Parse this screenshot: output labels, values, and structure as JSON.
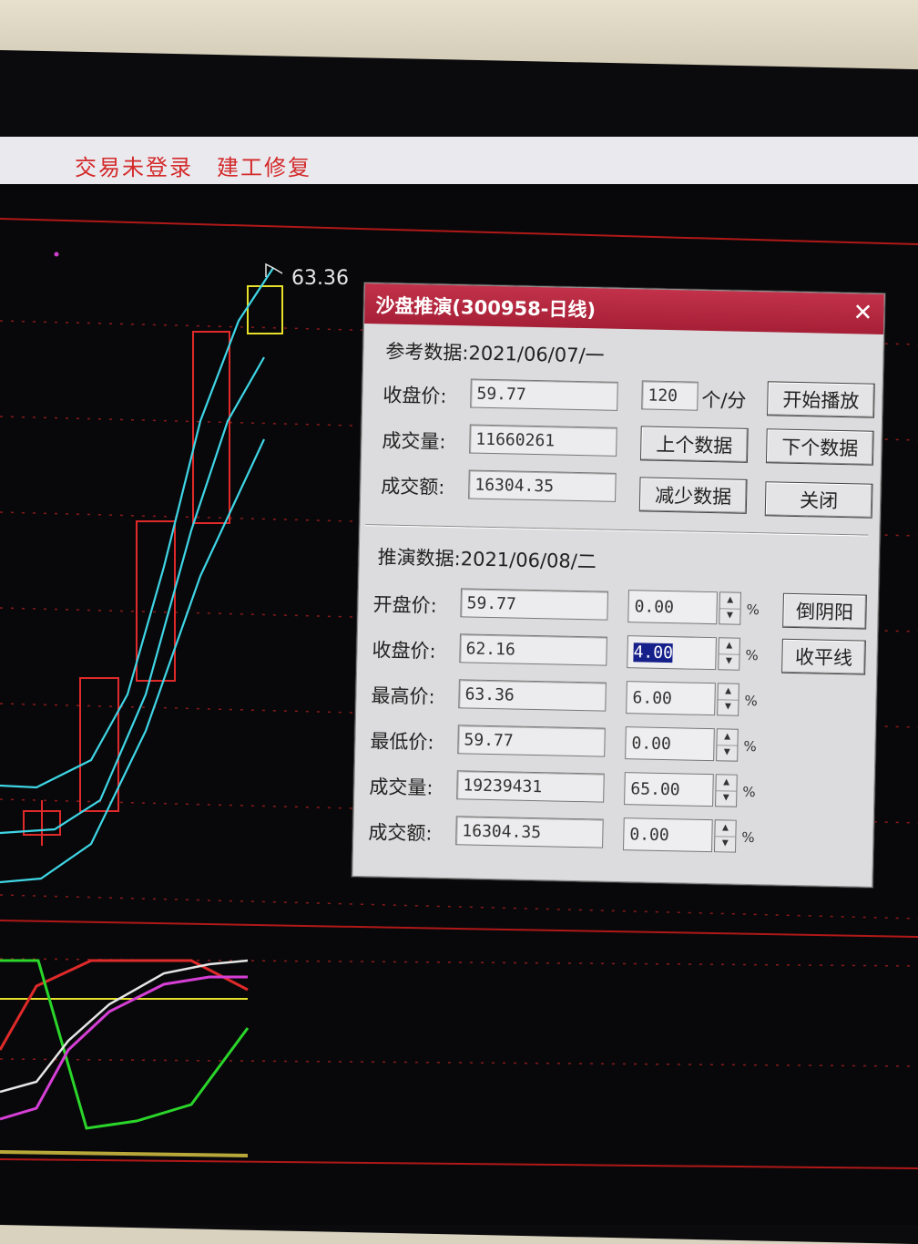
{
  "status": {
    "text": "交易未登录　建工修复"
  },
  "chart": {
    "price_label": "63.36",
    "colors": {
      "up": "#e02a2a",
      "ma": "#3fd6e6",
      "grid": "#a02020",
      "highlight": "#e6e02a",
      "green": "#2ad62a",
      "magenta": "#d63fd6",
      "white": "#e6e6e6"
    }
  },
  "dialog": {
    "title": "沙盘推演(300958-日线)",
    "close_icon": "close-icon",
    "ref": {
      "header": "参考数据:2021/06/07/一",
      "close_label": "收盘价:",
      "close_value": "59.77",
      "volume_label": "成交量:",
      "volume_value": "11660261",
      "amount_label": "成交额:",
      "amount_value": "16304.35",
      "speed_value": "120",
      "speed_unit": "个/分",
      "btn_play": "开始播放",
      "btn_prev": "上个数据",
      "btn_next": "下个数据",
      "btn_reduce": "减少数据",
      "btn_close": "关闭"
    },
    "sim": {
      "header": "推演数据:2021/06/08/二",
      "rows": [
        {
          "label": "开盘价:",
          "value": "59.77",
          "pct": "0.00"
        },
        {
          "label": "收盘价:",
          "value": "62.16",
          "pct": "4.00"
        },
        {
          "label": "最高价:",
          "value": "63.36",
          "pct": "6.00"
        },
        {
          "label": "最低价:",
          "value": "59.77",
          "pct": "0.00"
        },
        {
          "label": "成交量:",
          "value": "19239431",
          "pct": "65.00"
        },
        {
          "label": "成交额:",
          "value": "16304.35",
          "pct": "0.00"
        }
      ],
      "percent_sign": "%",
      "btn_inverse": "倒阴阳",
      "btn_flat": "收平线"
    }
  }
}
